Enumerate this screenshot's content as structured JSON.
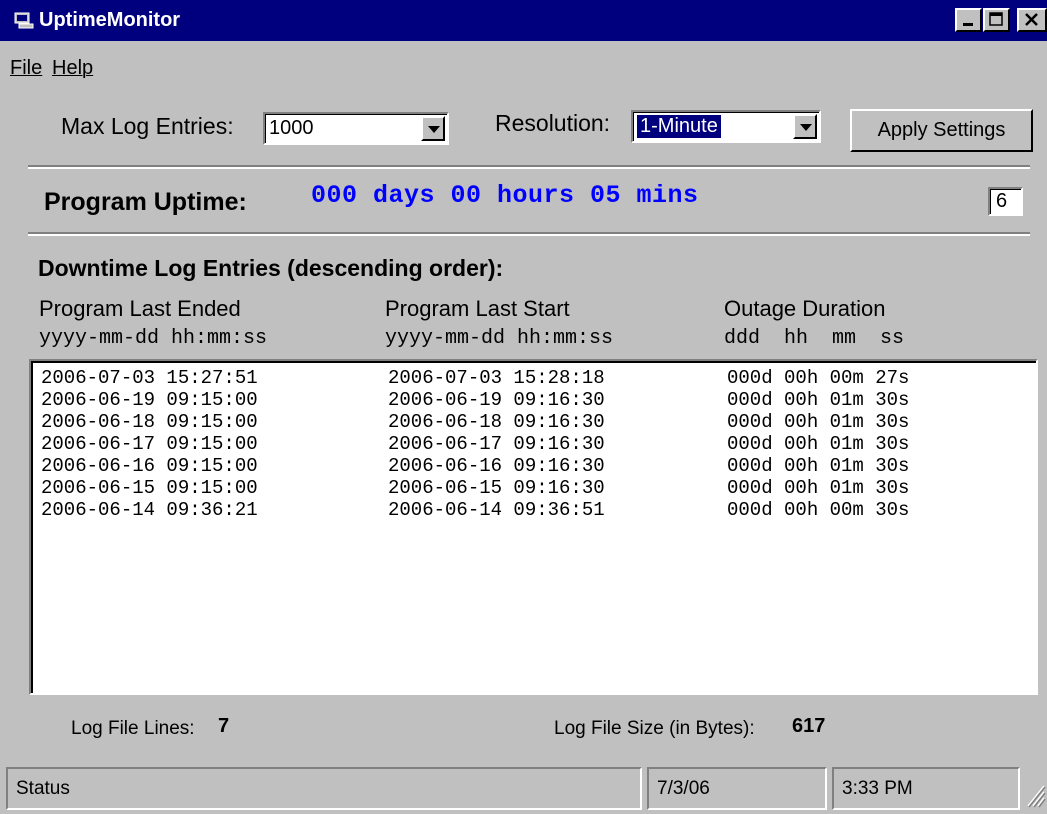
{
  "window": {
    "title": "UptimeMonitor"
  },
  "menu": {
    "file_label": "File",
    "help_label": "Help"
  },
  "settings": {
    "max_log_label": "Max Log Entries:",
    "max_log_value": "1000",
    "resolution_label": "Resolution:",
    "resolution_value": "1-Minute",
    "apply_label": "Apply Settings"
  },
  "uptime": {
    "label": "Program Uptime:",
    "value": "000 days 00 hours 05 mins",
    "counter": "6"
  },
  "log": {
    "heading": "Downtime Log Entries (descending order):",
    "columns": [
      {
        "title": "Program Last Ended",
        "format": "yyyy-mm-dd hh:mm:ss"
      },
      {
        "title": "Program Last Start",
        "format": "yyyy-mm-dd hh:mm:ss"
      },
      {
        "title": "Outage Duration",
        "format": "ddd  hh  mm  ss"
      }
    ],
    "rows": [
      [
        "2006-07-03 15:27:51",
        "2006-07-03 15:28:18",
        "000d 00h 00m 27s"
      ],
      [
        "2006-06-19 09:15:00",
        "2006-06-19 09:16:30",
        "000d 00h 01m 30s"
      ],
      [
        "2006-06-18 09:15:00",
        "2006-06-18 09:16:30",
        "000d 00h 01m 30s"
      ],
      [
        "2006-06-17 09:15:00",
        "2006-06-17 09:16:30",
        "000d 00h 01m 30s"
      ],
      [
        "2006-06-16 09:15:00",
        "2006-06-16 09:16:30",
        "000d 00h 01m 30s"
      ],
      [
        "2006-06-15 09:15:00",
        "2006-06-15 09:16:30",
        "000d 00h 01m 30s"
      ],
      [
        "2006-06-14 09:36:21",
        "2006-06-14 09:36:51",
        "000d 00h 00m 30s"
      ]
    ]
  },
  "footer": {
    "lines_label": "Log File Lines:",
    "lines_value": "7",
    "size_label": "Log File Size (in Bytes):",
    "size_value": "617"
  },
  "statusbar": {
    "status": "Status",
    "date": "7/3/06",
    "time": "3:33 PM"
  },
  "colors": {
    "titlebar": "#00007f",
    "uptime_text": "#0000ff",
    "face": "#c0c0c0"
  }
}
